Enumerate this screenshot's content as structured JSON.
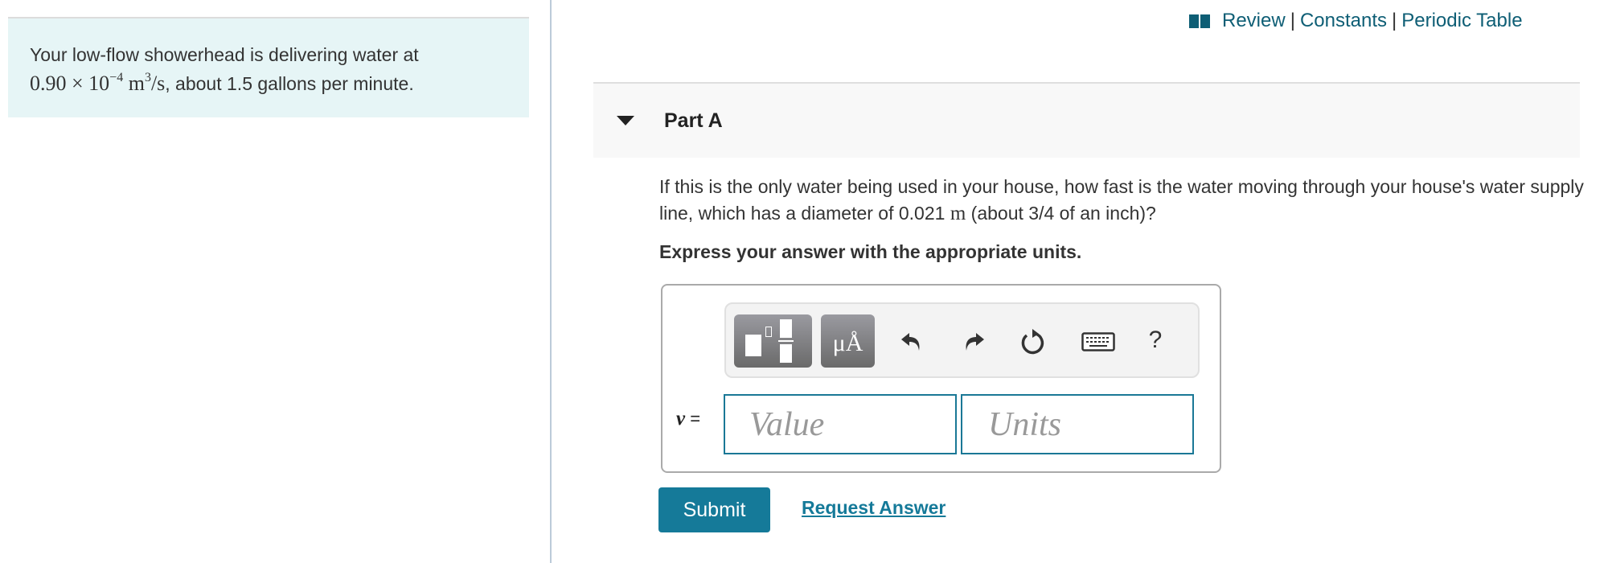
{
  "intro": {
    "text_prefix": "Your low-flow showerhead is delivering water at",
    "flow_value": "0.90 × 10",
    "flow_exponent": "−4",
    "flow_unit_base": "m",
    "flow_unit_exponent": "3",
    "flow_unit_suffix": "/s",
    "text_suffix": ", about 1.5 gallons per minute."
  },
  "header_links": {
    "icon": "book-icon",
    "review": "Review",
    "separator": "|",
    "constants": "Constants",
    "periodic_table": "Periodic Table"
  },
  "part": {
    "title": "Part A",
    "expanded": true,
    "question_part1": "If this is the only water being used in your house, how fast is the water moving through your house's water supply line, which has a diameter of 0.021 ",
    "question_unit": "m",
    "question_part2": " (about 3/4 of an inch)?",
    "instruction": "Express your answer with the appropriate units."
  },
  "toolbar": {
    "template_button": "templates-icon",
    "units_button_label": "μÅ",
    "undo": "undo-icon",
    "redo": "redo-icon",
    "reset": "reset-icon",
    "keyboard": "keyboard-icon",
    "help_label": "?"
  },
  "answer": {
    "variable": "v",
    "equals": "=",
    "value_placeholder": "Value",
    "value": "",
    "units_placeholder": "Units",
    "units": ""
  },
  "actions": {
    "submit_label": "Submit",
    "request_answer_label": "Request Answer"
  },
  "colors": {
    "accent": "#157a99",
    "link": "#0e5e75",
    "intro_background": "#e6f5f6"
  }
}
